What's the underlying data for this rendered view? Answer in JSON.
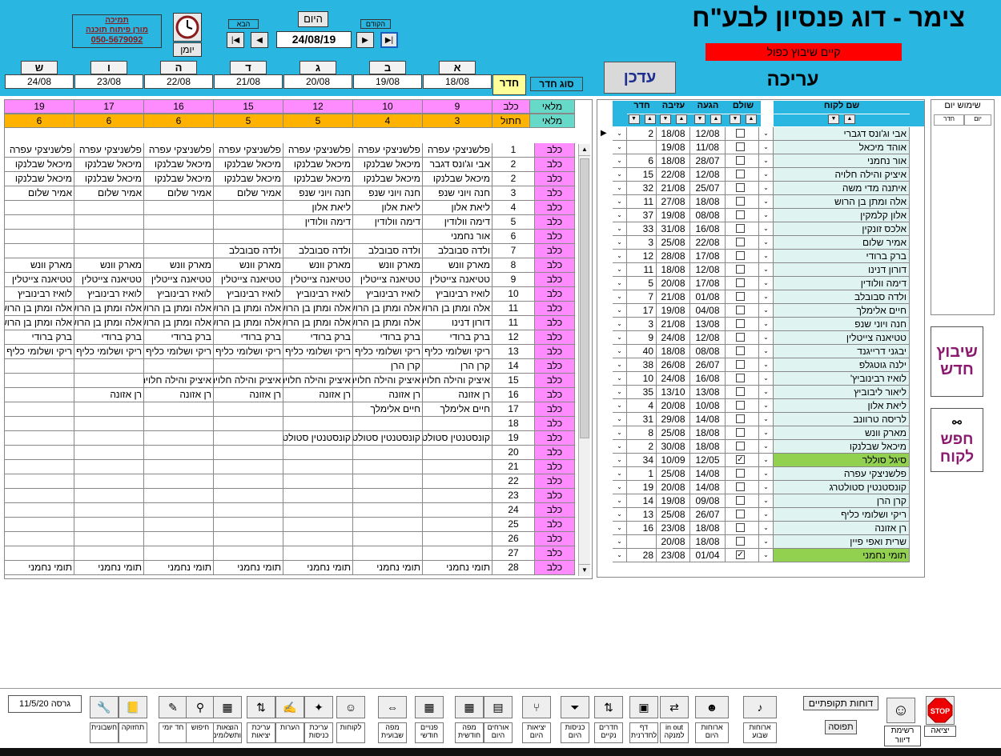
{
  "app_title": "צימר - דוג פנסיון לבע\"ח",
  "warning": "קיים שיבוץ כפול",
  "mode": "עריכה",
  "update_button": "עדכן",
  "support": {
    "title": "תמיכה",
    "name": "מורן פיתוח תוכנה",
    "phone": "050-5679092"
  },
  "diary_label": "יומן",
  "nav": {
    "today": "היום",
    "prev": "הקודם",
    "next": "הבא",
    "date": "24/08/19"
  },
  "room_type_label": "סוג חדר",
  "room_label": "חדר",
  "days": [
    {
      "day": "א",
      "date": "18/08"
    },
    {
      "day": "ב",
      "date": "19/08"
    },
    {
      "day": "ג",
      "date": "20/08"
    },
    {
      "day": "ד",
      "date": "21/08"
    },
    {
      "day": "ה",
      "date": "22/08"
    },
    {
      "day": "ו",
      "date": "23/08"
    },
    {
      "day": "ש",
      "date": "24/08"
    }
  ],
  "summary": {
    "row1_label": "כלב",
    "row1_status": "מלאי",
    "row1": [
      "9",
      "10",
      "12",
      "15",
      "16",
      "17",
      "19"
    ],
    "row2_label": "חתול",
    "row2_status": "מלאי",
    "row2": [
      "3",
      "4",
      "5",
      "5",
      "6",
      "6",
      "6"
    ]
  },
  "grid_rows": [
    {
      "type": "כלב",
      "room": "1",
      "cells": [
        "פלשניצקי עפרה",
        "פלשניצקי עפרה",
        "פלשניצקי עפרה",
        "פלשניצקי עפרה",
        "פלשניצקי עפרה",
        "פלשניצקי עפרה",
        "פלשניצקי עפרה"
      ]
    },
    {
      "type": "כלב",
      "room": "2",
      "cells": [
        "אבי וג'ונס דגבר",
        "מיכאל שבלנקו",
        "מיכאל שבלנקו",
        "מיכאל שבלנקו",
        "מיכאל שבלנקו",
        "מיכאל שבלנקו",
        "מיכאל שבלנקו"
      ]
    },
    {
      "type": "כלב",
      "room": "2",
      "cells": [
        "מיכאל שבלנקו",
        "מיכאל שבלנקו",
        "מיכאל שבלנקו",
        "מיכאל שבלנקו",
        "מיכאל שבלנקו",
        "מיכאל שבלנקו",
        "מיכאל שבלנקו"
      ]
    },
    {
      "type": "כלב",
      "room": "3",
      "cells": [
        "חנה ויוני שנפ",
        "חנה ויוני שנפ",
        "חנה ויוני שנפ",
        "אמיר שלום",
        "אמיר שלום",
        "אמיר שלום",
        "אמיר שלום"
      ]
    },
    {
      "type": "כלב",
      "room": "4",
      "cells": [
        "ליאת אלון",
        "ליאת אלון",
        "ליאת אלון",
        "",
        "",
        "",
        ""
      ]
    },
    {
      "type": "כלב",
      "room": "5",
      "cells": [
        "דימה וולודין",
        "דימה וולודין",
        "דימה וולודין",
        "",
        "",
        "",
        ""
      ]
    },
    {
      "type": "כלב",
      "room": "6",
      "cells": [
        "אור נחמני",
        "",
        "",
        "",
        "",
        "",
        ""
      ]
    },
    {
      "type": "כלב",
      "room": "7",
      "cells": [
        "ולדה סבובלב",
        "ולדה סבובלב",
        "ולדה סבובלב",
        "ולדה סבובלב",
        "",
        "",
        ""
      ]
    },
    {
      "type": "כלב",
      "room": "8",
      "cells": [
        "מארק וונש",
        "מארק וונש",
        "מארק וונש",
        "מארק וונש",
        "מארק וונש",
        "מארק וונש",
        "מארק וונש"
      ]
    },
    {
      "type": "כלב",
      "room": "9",
      "cells": [
        "טטיאנה צייטלין",
        "טטיאנה צייטלין",
        "טטיאנה צייטלין",
        "טטיאנה צייטלין",
        "טטיאנה צייטלין",
        "טטיאנה צייטלין",
        "טטיאנה צייטלין"
      ]
    },
    {
      "type": "כלב",
      "room": "10",
      "cells": [
        "לואיז רבינוביץ",
        "לואיז רבינוביץ",
        "לואיז רבינוביץ",
        "לואיז רבינוביץ",
        "לואיז רבינוביץ",
        "לואיז רבינוביץ",
        "לואיז רבינוביץ"
      ]
    },
    {
      "type": "כלב",
      "room": "11",
      "cells": [
        "אלה ומתן בן הרוש",
        "אלה ומתן בן הרוש",
        "אלה ומתן בן הרוש",
        "אלה ומתן בן הרוש",
        "אלה ומתן בן הרוש",
        "אלה ומתן בן הרוש",
        "אלה ומתן בן הרוש"
      ]
    },
    {
      "type": "כלב",
      "room": "11",
      "cells": [
        "דורון דנינו",
        "אלה ומתן בן הרוש",
        "אלה ומתן בן הרוש",
        "אלה ומתן בן הרוש",
        "אלה ומתן בן הרוש",
        "אלה ומתן בן הרוש",
        "אלה ומתן בן הרוש"
      ]
    },
    {
      "type": "כלב",
      "room": "12",
      "cells": [
        "ברק ברודי",
        "ברק ברודי",
        "ברק ברודי",
        "ברק ברודי",
        "ברק ברודי",
        "ברק ברודי",
        "ברק ברודי"
      ]
    },
    {
      "type": "כלב",
      "room": "13",
      "cells": [
        "ריקי ושלומי כליף",
        "ריקי ושלומי כליף",
        "ריקי ושלומי כליף",
        "ריקי ושלומי כליף",
        "ריקי ושלומי כליף",
        "ריקי ושלומי כליף",
        "ריקי ושלומי כליף"
      ]
    },
    {
      "type": "כלב",
      "room": "14",
      "cells": [
        "קרן הרן",
        "קרן הרן",
        "",
        "",
        "",
        "",
        ""
      ]
    },
    {
      "type": "כלב",
      "room": "15",
      "cells": [
        "איציק והילה חלויה",
        "איציק והילה חלויה",
        "איציק והילה חלויה",
        "איציק והילה חלויה",
        "איציק והילה חלויה",
        "",
        ""
      ]
    },
    {
      "type": "כלב",
      "room": "16",
      "cells": [
        "רן אזונה",
        "רן אזונה",
        "רן אזונה",
        "רן אזונה",
        "רן אזונה",
        "רן אזונה",
        ""
      ]
    },
    {
      "type": "כלב",
      "room": "17",
      "cells": [
        "חיים אלימלך",
        "חיים אלימלך",
        "",
        "",
        "",
        "",
        ""
      ]
    },
    {
      "type": "כלב",
      "room": "18",
      "cells": [
        "",
        "",
        "",
        "",
        "",
        "",
        ""
      ]
    },
    {
      "type": "כלב",
      "room": "19",
      "cells": [
        "קונסטנטין סטולטרג",
        "קונסטנטין סטולטרג",
        "קונסטנטין סטולטרג",
        "",
        "",
        "",
        ""
      ]
    },
    {
      "type": "כלב",
      "room": "20",
      "cells": [
        "",
        "",
        "",
        "",
        "",
        "",
        ""
      ]
    },
    {
      "type": "כלב",
      "room": "21",
      "cells": [
        "",
        "",
        "",
        "",
        "",
        "",
        ""
      ]
    },
    {
      "type": "כלב",
      "room": "22",
      "cells": [
        "",
        "",
        "",
        "",
        "",
        "",
        ""
      ]
    },
    {
      "type": "כלב",
      "room": "23",
      "cells": [
        "",
        "",
        "",
        "",
        "",
        "",
        ""
      ]
    },
    {
      "type": "כלב",
      "room": "24",
      "cells": [
        "",
        "",
        "",
        "",
        "",
        "",
        ""
      ]
    },
    {
      "type": "כלב",
      "room": "25",
      "cells": [
        "",
        "",
        "",
        "",
        "",
        "",
        ""
      ]
    },
    {
      "type": "כלב",
      "room": "26",
      "cells": [
        "",
        "",
        "",
        "",
        "",
        "",
        ""
      ]
    },
    {
      "type": "כלב",
      "room": "27",
      "cells": [
        "",
        "",
        "",
        "",
        "",
        "",
        ""
      ]
    },
    {
      "type": "כלב",
      "room": "28",
      "cells": [
        "תומי נחמני",
        "תומי נחמני",
        "תומי נחמני",
        "תומי נחמני",
        "תומי נחמני",
        "תומי נחמני",
        "תומי נחמני"
      ]
    }
  ],
  "customers_headers": {
    "name": "שם לקוח",
    "paid": "שולם",
    "arrival": "הגעה",
    "departure": "עזיבה",
    "room": "חדר"
  },
  "customers": [
    {
      "name": "אבי וג'ונס דגברי",
      "paid": false,
      "arrival": "12/08",
      "departure": "18/08",
      "room": "2",
      "hl": ""
    },
    {
      "name": "אוהד מיכאל",
      "paid": false,
      "arrival": "11/08",
      "departure": "19/08",
      "room": "",
      "hl": ""
    },
    {
      "name": "אור נחמני",
      "paid": false,
      "arrival": "28/07",
      "departure": "18/08",
      "room": "6",
      "hl": ""
    },
    {
      "name": "איציק והילה חלויה",
      "paid": false,
      "arrival": "12/08",
      "departure": "22/08",
      "room": "15",
      "hl": ""
    },
    {
      "name": "איתנה מדי משה",
      "paid": false,
      "arrival": "25/07",
      "departure": "21/08",
      "room": "32",
      "hl": ""
    },
    {
      "name": "אלה ומתן בן הרוש",
      "paid": false,
      "arrival": "18/08",
      "departure": "27/08",
      "room": "11",
      "hl": ""
    },
    {
      "name": "אלון קלמקין",
      "paid": false,
      "arrival": "08/08",
      "departure": "19/08",
      "room": "37",
      "hl": ""
    },
    {
      "name": "אלכס זונקין",
      "paid": false,
      "arrival": "16/08",
      "departure": "31/08",
      "room": "33",
      "hl": ""
    },
    {
      "name": "אמיר שלום",
      "paid": false,
      "arrival": "22/08",
      "departure": "25/08",
      "room": "3",
      "hl": ""
    },
    {
      "name": "ברק ברודי",
      "paid": false,
      "arrival": "17/08",
      "departure": "28/08",
      "room": "12",
      "hl": ""
    },
    {
      "name": "דורון דנינו",
      "paid": false,
      "arrival": "12/08",
      "departure": "18/08",
      "room": "11",
      "hl": ""
    },
    {
      "name": "דימה וולודין",
      "paid": false,
      "arrival": "17/08",
      "departure": "20/08",
      "room": "5",
      "hl": ""
    },
    {
      "name": "ולדה סבובלב",
      "paid": false,
      "arrival": "01/08",
      "departure": "21/08",
      "room": "7",
      "hl": ""
    },
    {
      "name": "חיים אלימלך",
      "paid": false,
      "arrival": "04/08",
      "departure": "19/08",
      "room": "17",
      "hl": ""
    },
    {
      "name": "חנה ויוני שנפ",
      "paid": false,
      "arrival": "13/08",
      "departure": "21/08",
      "room": "3",
      "hl": ""
    },
    {
      "name": "טטיאנה צייטלין",
      "paid": false,
      "arrival": "12/08",
      "departure": "24/08",
      "room": "9",
      "hl": ""
    },
    {
      "name": "יבגני דרייגנד",
      "paid": false,
      "arrival": "08/08",
      "departure": "18/08",
      "room": "40",
      "hl": ""
    },
    {
      "name": "ילנה גוטגלפ",
      "paid": false,
      "arrival": "26/07",
      "departure": "26/08",
      "room": "38",
      "hl": ""
    },
    {
      "name": "לואיז רבינוביץ'",
      "paid": false,
      "arrival": "16/08",
      "departure": "24/08",
      "room": "10",
      "hl": ""
    },
    {
      "name": "ליאור ליבוביץ",
      "paid": false,
      "arrival": "13/08",
      "departure": "13/10",
      "room": "35",
      "hl": ""
    },
    {
      "name": "ליאת אלון",
      "paid": false,
      "arrival": "10/08",
      "departure": "20/08",
      "room": "4",
      "hl": ""
    },
    {
      "name": "לריסה טרוונב",
      "paid": false,
      "arrival": "14/08",
      "departure": "29/08",
      "room": "31",
      "hl": ""
    },
    {
      "name": "מארק וונש",
      "paid": false,
      "arrival": "18/08",
      "departure": "25/08",
      "room": "8",
      "hl": ""
    },
    {
      "name": "מיכאל שבלנקו",
      "paid": false,
      "arrival": "18/08",
      "departure": "30/08",
      "room": "2",
      "hl": ""
    },
    {
      "name": "סיגל סוללר",
      "paid": true,
      "arrival": "12/05",
      "departure": "10/09",
      "room": "34",
      "hl": "green"
    },
    {
      "name": "פלשניצקי עפרה",
      "paid": false,
      "arrival": "14/08",
      "departure": "25/08",
      "room": "1",
      "hl": ""
    },
    {
      "name": "קונסטנטין סטולטרג",
      "paid": false,
      "arrival": "14/08",
      "departure": "20/08",
      "room": "19",
      "hl": ""
    },
    {
      "name": "קרן הרן",
      "paid": false,
      "arrival": "09/08",
      "departure": "19/08",
      "room": "14",
      "hl": ""
    },
    {
      "name": "ריקי ושלומי כליף",
      "paid": false,
      "arrival": "26/07",
      "departure": "25/08",
      "room": "13",
      "hl": ""
    },
    {
      "name": "רן אזונה",
      "paid": false,
      "arrival": "18/08",
      "departure": "23/08",
      "room": "16",
      "hl": ""
    },
    {
      "name": "שרית ואפי פיין",
      "paid": false,
      "arrival": "18/08",
      "departure": "20/08",
      "room": "",
      "hl": ""
    },
    {
      "name": "תומי נחמני",
      "paid": true,
      "arrival": "01/04",
      "departure": "23/08",
      "room": "28",
      "hl": "green"
    }
  ],
  "day_usage": {
    "title": "שימוש יום",
    "col1": "חדר",
    "col2": "יום"
  },
  "new_booking": "שיבוץ חדש",
  "find_customer": "חפש לקוח",
  "version": {
    "label": "גרסה",
    "date": "11/5/20"
  },
  "periodic_reports": "דוחות תקופתיים",
  "print_label": "תפוסה",
  "exit_label": "יציאה",
  "exit_icon_text": "STOP",
  "driver_label": "רשימת דיוור",
  "toolbar": [
    {
      "icon": "wrench-icon",
      "glyph": "🔧",
      "label": "חשבונית"
    },
    {
      "icon": "notebook-icon",
      "glyph": "📒",
      "label": "תחזוקה"
    },
    {
      "icon": "pencil-icon",
      "glyph": "✎",
      "label": "חד יומי"
    },
    {
      "icon": "binoculars-icon",
      "glyph": "⚲",
      "label": "חיפוש"
    },
    {
      "icon": "excel-icon",
      "glyph": "▦",
      "label": "הוצאות ותשלומים"
    },
    {
      "icon": "arrows-icon",
      "glyph": "⇅",
      "label": "עריכת יציאות"
    },
    {
      "icon": "note-icon",
      "glyph": "✍",
      "label": "הערות"
    },
    {
      "icon": "wand-icon",
      "glyph": "✦",
      "label": "עריכת כניסות"
    },
    {
      "icon": "smile-icon",
      "glyph": "☺",
      "label": "לקוחות"
    },
    {
      "icon": "grid-arrows-icon",
      "glyph": "⇔",
      "label": "מפה שבועית"
    },
    {
      "icon": "excel-icon",
      "glyph": "▦",
      "label": "פנויים חודשי"
    },
    {
      "icon": "calendar-grid-icon",
      "glyph": "▦",
      "label": "מפה חודשית"
    },
    {
      "icon": "table-icon",
      "glyph": "▤",
      "label": "אורחים היום"
    },
    {
      "icon": "fork-icon",
      "glyph": "⑂",
      "label": "יציאות היום"
    },
    {
      "icon": "filter-icon",
      "glyph": "⏷",
      "label": "כניסות היום"
    },
    {
      "icon": "stack-icon",
      "glyph": "⇅",
      "label": "חדרים נקיים"
    },
    {
      "icon": "boxes-icon",
      "glyph": "▣",
      "label": "דף לחדרנית"
    },
    {
      "icon": "inout-icon",
      "glyph": "⇄",
      "label": "in out למנקה"
    },
    {
      "icon": "faces-icon",
      "glyph": "☻",
      "label": "ארוחות היום"
    },
    {
      "icon": "sound-icon",
      "glyph": "♪",
      "label": "ארוחות שבוע"
    }
  ]
}
